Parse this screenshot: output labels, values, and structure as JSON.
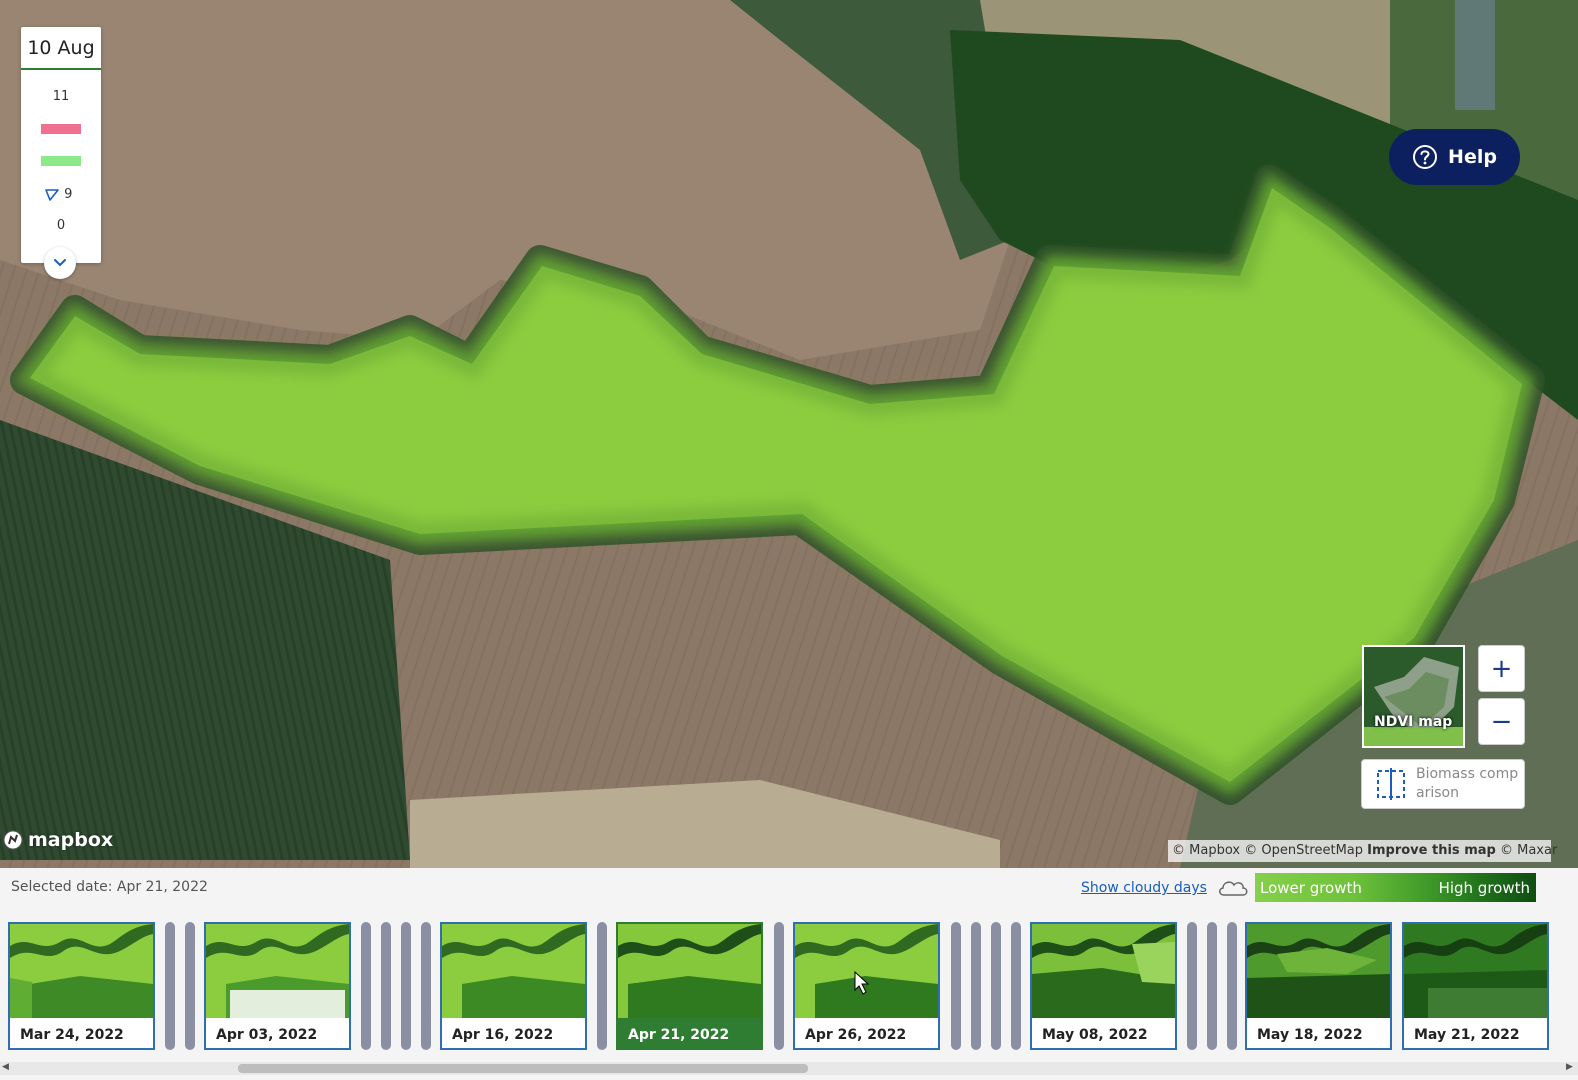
{
  "map": {
    "legend": {
      "date": "10 Aug",
      "value_top": "11",
      "value_mid": "9",
      "value_bottom": "0",
      "swatch_1_color": "#f0708f",
      "swatch_2_color": "#8ce98a"
    },
    "help_label": "Help",
    "ndvi_label": "NDVI map",
    "zoom_in": "+",
    "zoom_out": "−",
    "biomass_label": "Biomass comparison",
    "mapbox_logo": "mapbox",
    "attribution": {
      "mapbox": "© Mapbox",
      "osm": "© OpenStreetMap",
      "improve": "Improve this map",
      "maxar": "© Maxar"
    }
  },
  "timeline": {
    "selected_date": "Selected date: Apr 21, 2022",
    "cloudy_link": "Show cloudy days",
    "scale_low": "Lower growth",
    "scale_high": "High growth",
    "cards": [
      {
        "label": "Mar 24, 2022"
      },
      {
        "label": "Apr 03, 2022"
      },
      {
        "label": "Apr 16, 2022"
      },
      {
        "label": "Apr 21, 2022"
      },
      {
        "label": "Apr 26, 2022"
      },
      {
        "label": "May 08, 2022"
      },
      {
        "label": "May 18, 2022"
      },
      {
        "label": "May 21, 2022"
      }
    ]
  },
  "colors": {
    "field_green": "#8ccc3f",
    "help_navy": "#0c1f5e",
    "active_green": "#2e7d32",
    "card_border": "#2f6fb0",
    "link_blue": "#1a5cbf"
  }
}
